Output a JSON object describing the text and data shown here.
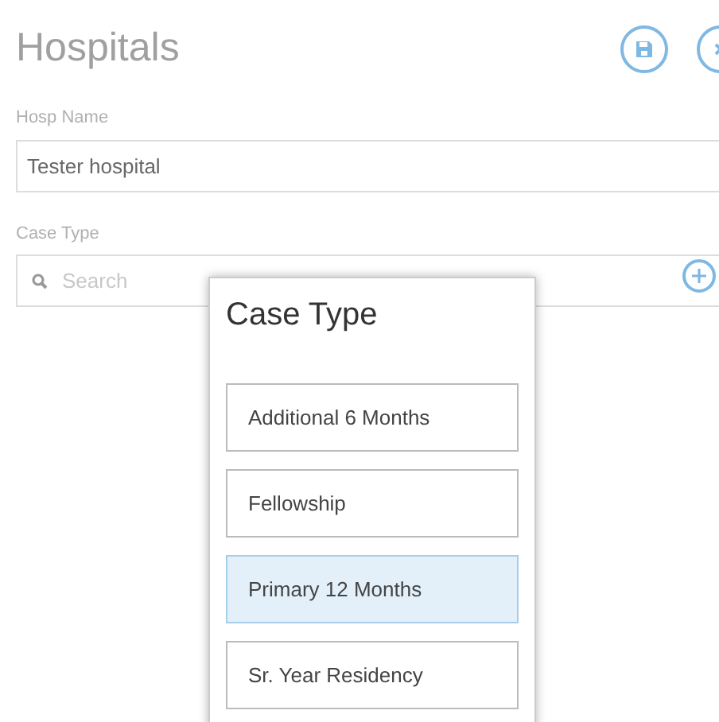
{
  "title": "Hospitals",
  "fields": [
    {
      "label": "Hosp Name",
      "value": "Tester hospital"
    },
    {
      "label": "Case Type",
      "placeholder": "Search"
    }
  ],
  "popup": {
    "title": "Case Type",
    "options": [
      {
        "label": "Additional 6 Months",
        "selected": false
      },
      {
        "label": "Fellowship",
        "selected": false
      },
      {
        "label": "Primary 12 Months",
        "selected": true
      },
      {
        "label": "Sr. Year Residency",
        "selected": false
      }
    ]
  }
}
